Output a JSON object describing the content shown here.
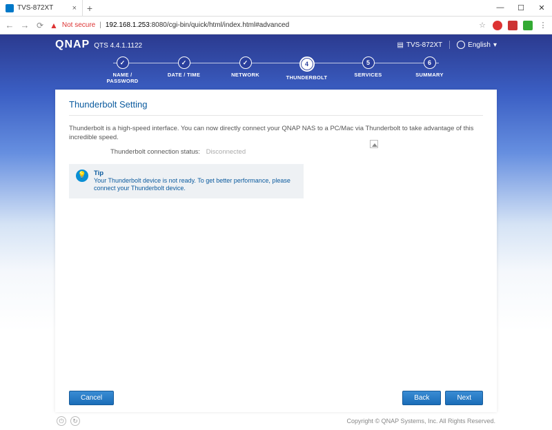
{
  "browser": {
    "tab_title": "TVS-872XT",
    "url_notsecure": "Not secure",
    "url_host": "192.168.1.253",
    "url_path": ":8080/cgi-bin/quick/html/index.html#advanced"
  },
  "header": {
    "brand": "QNAP",
    "version": "QTS 4.4.1.1122",
    "device": "TVS-872XT",
    "language": "English"
  },
  "steps": [
    {
      "label": "NAME /\nPASSWORD",
      "state": "done"
    },
    {
      "label": "DATE / TIME",
      "state": "done"
    },
    {
      "label": "NETWORK",
      "state": "done"
    },
    {
      "label": "THUNDERBOLT",
      "state": "current",
      "num": "4"
    },
    {
      "label": "SERVICES",
      "state": "todo",
      "num": "5"
    },
    {
      "label": "SUMMARY",
      "state": "todo",
      "num": "6"
    }
  ],
  "main": {
    "title": "Thunderbolt Setting",
    "description": "Thunderbolt is a high-speed interface. You can now directly connect your QNAP NAS to a PC/Mac via Thunderbolt to take advantage of this incredible speed.",
    "status_label": "Thunderbolt connection status:",
    "status_value": "Disconnected",
    "tip_heading": "Tip",
    "tip_body": "Your Thunderbolt device is not ready. To get better performance, please connect your Thunderbolt device."
  },
  "buttons": {
    "cancel": "Cancel",
    "back": "Back",
    "next": "Next"
  },
  "footer": {
    "copyright": "Copyright © QNAP Systems, Inc. All Rights Reserved."
  }
}
